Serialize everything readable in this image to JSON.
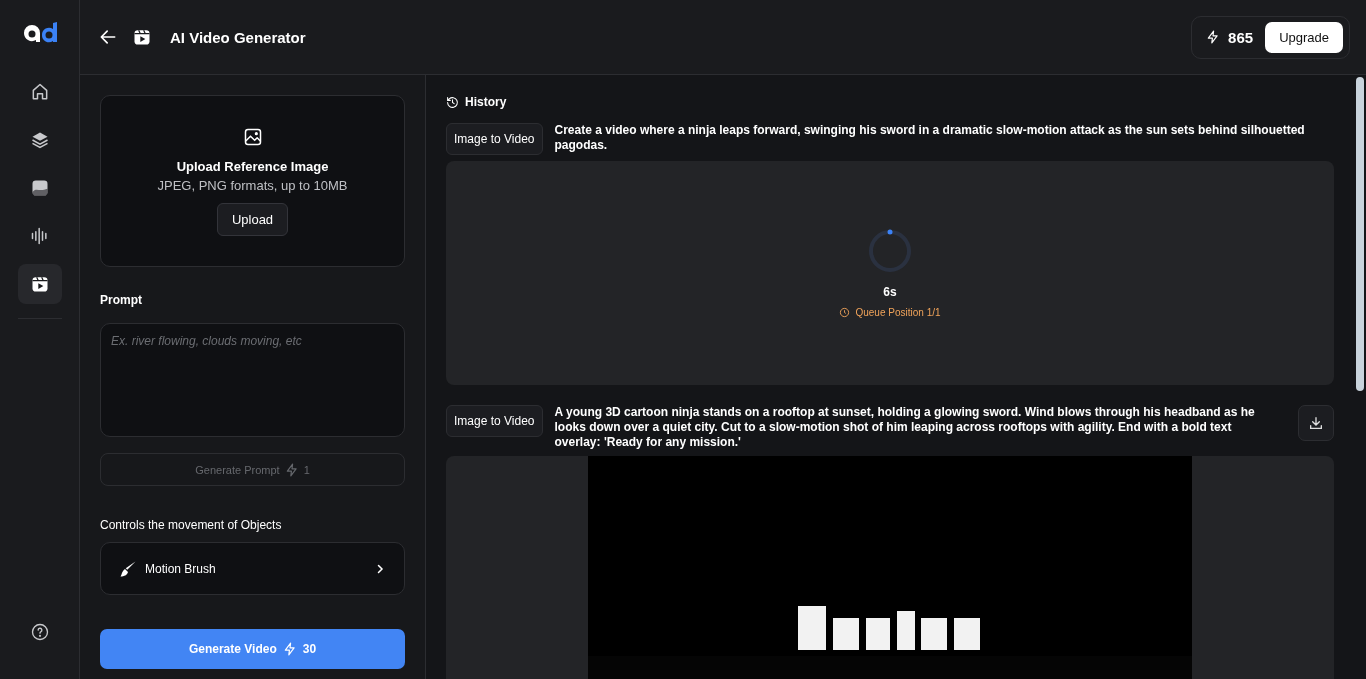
{
  "sidebar": {
    "items": [
      {
        "selected": false
      },
      {
        "selected": false
      },
      {
        "selected": false
      },
      {
        "selected": false
      },
      {
        "selected": true
      }
    ]
  },
  "header": {
    "title": "AI Video Generator",
    "credits": "865",
    "upgrade": "Upgrade"
  },
  "upload": {
    "title": "Upload Reference Image",
    "hint": "JPEG, PNG formats, up to 10MB",
    "button": "Upload"
  },
  "prompt": {
    "label": "Prompt",
    "placeholder": "Ex. river flowing, clouds moving, etc",
    "generate": {
      "label": "Generate Prompt",
      "cost": "1",
      "disabled": true
    }
  },
  "controls": {
    "label": "Controls the movement of Objects",
    "item": "Motion Brush"
  },
  "generate_video": {
    "label": "Generate Video",
    "cost": "30"
  },
  "history": {
    "title": "History",
    "entries": [
      {
        "kind": "pending",
        "tag": "Image to Video",
        "prompt": "Create a video where a ninja leaps forward, swinging his sword in a dramatic slow-motion attack as the sun sets behind silhouetted pagodas.",
        "timer": "6s",
        "queue": "Queue Position 1/1"
      },
      {
        "kind": "video",
        "tag": "Image to Video",
        "prompt": "A young 3D cartoon ninja stands on a rooftop at sunset, holding a glowing sword. Wind blows through his headband as he looks down over a quiet city. Cut to a slow-motion shot of him leaping across rooftops with agility. End with a bold text overlay: 'Ready for any mission.'"
      }
    ]
  }
}
